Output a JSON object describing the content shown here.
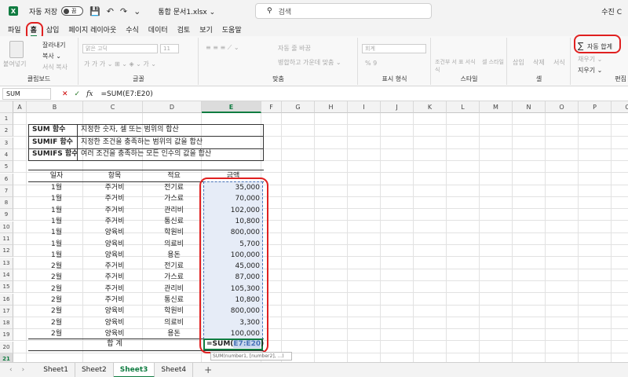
{
  "titlebar": {
    "autosave_label": "자동 저장",
    "toggle_state": "끔",
    "doc_title": "통합 문서1.xlsx ⌄",
    "search_placeholder": "검색",
    "user": "수진 C"
  },
  "tabs": [
    "파일",
    "홈",
    "삽입",
    "페이지 레이아웃",
    "수식",
    "데이터",
    "검토",
    "보기",
    "도움말"
  ],
  "active_tab": "홈",
  "ribbon": {
    "paste": "붙여넣기",
    "cut": "잘라내기",
    "copy": "복사 ⌄",
    "format_painter": "서식 복사",
    "clipboard": "클립보드",
    "font_name": "맑은 고딕",
    "font_size": "11",
    "font": "글꼴",
    "wrap_text": "자동 줄 바꿈",
    "merge_center": "병합하고 가운데 맞춤 ⌄",
    "alignment": "맞춤",
    "number_format": "회계",
    "number_symbols": "% 9",
    "number": "표시 형식",
    "cond_format": "조건부 서식",
    "format_table": "표 서식",
    "cell_styles": "셀 스타일",
    "styles": "스타일",
    "insert": "삽입",
    "delete": "삭제",
    "format": "서식",
    "cells": "셀",
    "autosum": "자동 합계",
    "fill": "채우기 ⌄",
    "clear": "지우기 ⌄",
    "editing": "편집"
  },
  "formula_bar": {
    "name_box": "SUM",
    "cancel": "✕",
    "enter": "✓",
    "fx": "fx",
    "formula": "=SUM(E7:E20)"
  },
  "columns": [
    "A",
    "B",
    "C",
    "D",
    "E",
    "F",
    "G",
    "H",
    "I",
    "J",
    "K",
    "L",
    "M",
    "N",
    "O",
    "P",
    "Q",
    "R",
    "S",
    "T",
    "U",
    "V"
  ],
  "selected_column": "E",
  "rows": [
    "1",
    "2",
    "3",
    "4",
    "5",
    "6",
    "7",
    "8",
    "9",
    "10",
    "11",
    "12",
    "13",
    "14",
    "15",
    "16",
    "17",
    "18",
    "19",
    "20",
    "21",
    "22"
  ],
  "selected_row": "21",
  "info_table": [
    {
      "name": "SUM 함수",
      "desc": "지정한 숫자, 셀 또는 범위의 합산"
    },
    {
      "name": "SUMIF 함수",
      "desc": "지정한 조건을 충족하는 범위의 값을 합산"
    },
    {
      "name": "SUMIFS 함수",
      "desc": "여러 조건을 충족하는 모든 인수의 값을 합산"
    }
  ],
  "data_header": {
    "month": "일자",
    "category": "항목",
    "summary": "적요",
    "amount": "금액"
  },
  "data_rows": [
    {
      "month": "1월",
      "category": "주거비",
      "summary": "전기료",
      "amount": "35,000"
    },
    {
      "month": "1월",
      "category": "주거비",
      "summary": "가스료",
      "amount": "70,000"
    },
    {
      "month": "1월",
      "category": "주거비",
      "summary": "관리비",
      "amount": "102,000"
    },
    {
      "month": "1월",
      "category": "주거비",
      "summary": "통신료",
      "amount": "10,800"
    },
    {
      "month": "1월",
      "category": "양육비",
      "summary": "학원비",
      "amount": "800,000"
    },
    {
      "month": "1월",
      "category": "양육비",
      "summary": "의료비",
      "amount": "5,700"
    },
    {
      "month": "1월",
      "category": "양육비",
      "summary": "용돈",
      "amount": "100,000"
    },
    {
      "month": "2월",
      "category": "주거비",
      "summary": "전기료",
      "amount": "45,000"
    },
    {
      "month": "2월",
      "category": "주거비",
      "summary": "가스료",
      "amount": "87,000"
    },
    {
      "month": "2월",
      "category": "주거비",
      "summary": "관리비",
      "amount": "105,300"
    },
    {
      "month": "2월",
      "category": "주거비",
      "summary": "통신료",
      "amount": "10,800"
    },
    {
      "month": "2월",
      "category": "양육비",
      "summary": "학원비",
      "amount": "800,000"
    },
    {
      "month": "2월",
      "category": "양육비",
      "summary": "의료비",
      "amount": "3,300"
    },
    {
      "month": "2월",
      "category": "양육비",
      "summary": "용돈",
      "amount": "100,000"
    }
  ],
  "total_label": "합  계",
  "active_cell": {
    "prefix": "=SUM(",
    "range": "E7:E20",
    "suffix": ")"
  },
  "tooltip": "SUM(number1, [number2], ...)",
  "sheets": [
    "Sheet1",
    "Sheet2",
    "Sheet3",
    "Sheet4"
  ],
  "active_sheet": "Sheet3",
  "colors": {
    "accent": "#107c41",
    "highlight": "#e02020",
    "selection": "#e6ecf7"
  }
}
